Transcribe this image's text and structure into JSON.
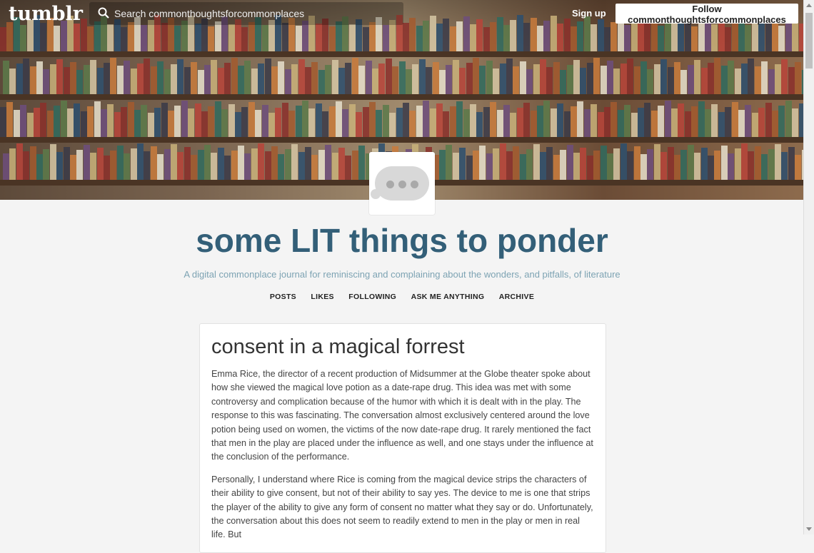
{
  "header": {
    "logo": "tumblr",
    "search_placeholder": "Search commonthoughtsforcommonplaces",
    "signup_label": "Sign up",
    "follow_label": "Follow commonthoughtsforcommonplaces"
  },
  "blog": {
    "title": "some LIT things to ponder",
    "description": "A digital commonplace journal for reminiscing and complaining about the wonders, and pitfalls, of literature",
    "nav": [
      "POSTS",
      "LIKES",
      "FOLLOWING",
      "ASK ME ANYTHING",
      "ARCHIVE"
    ]
  },
  "post": {
    "title": "consent in a magical forrest",
    "paragraphs": [
      "Emma Rice, the director of a recent production of Midsummer at the Globe theater spoke about how she viewed the magical love potion as a date-rape drug. This idea was met with some controversy and complication because of the humor with which it is dealt with in the play. The response to this was fascinating. The conversation almost exclusively centered around the love potion being used on women, the victims of the now date-rape drug. It rarely mentioned the fact that men in the play are placed under the influence as well, and one stays under the influence at the conclusion of the performance.",
      "Personally, I understand where Rice is coming from the magical device strips the characters of their ability to give consent, but not of their ability to say yes. The device to me is one that strips the player of the ability to give any form of consent no matter what they say or do. Unfortunately, the conversation about this does not seem to readily extend to men in the play or men in real life. But"
    ]
  },
  "colors": {
    "title": "#335f78",
    "description": "#7da3b3",
    "background": "#f4f4f4"
  }
}
